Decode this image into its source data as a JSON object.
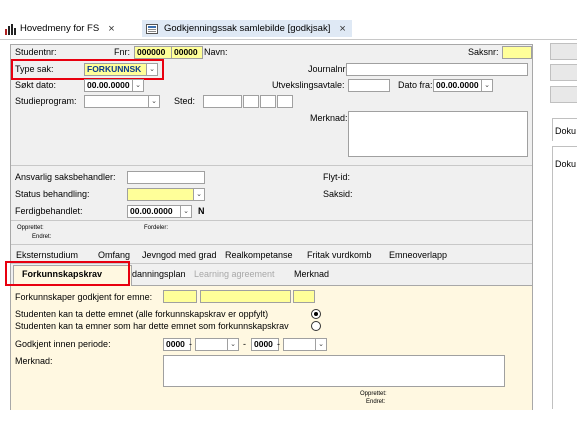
{
  "app_tabs": [
    {
      "label": "Hovedmeny for FS",
      "close": "×"
    },
    {
      "label": "Godkjenningssak samlebilde  [godkjsak]",
      "close": "×"
    }
  ],
  "header": {
    "studentnr_label": "Studentnr:",
    "fnr_label": "Fnr:",
    "fnr_value1": "000000",
    "fnr_value2": "00000",
    "navn_label": "Navn:",
    "saksnr_label": "Saksnr:",
    "type_sak_label": "Type sak:",
    "type_sak_value": "FORKUNNSK",
    "journalnr_label": "Journalnr:",
    "sokt_dato_label": "Søkt dato:",
    "sokt_dato_value": "00.00.0000",
    "utvekslingsavtale_label": "Utvekslingsavtale:",
    "dato_fra_label": "Dato fra:",
    "dato_fra_value": "00.00.0000",
    "studieprogram_label": "Studieprogram:",
    "sted_label": "Sted:",
    "merknad_label": "Merknad:"
  },
  "behandling": {
    "ansvarlig_label": "Ansvarlig saksbehandler:",
    "flyt_id_label": "Flyt-id:",
    "status_label": "Status behandling:",
    "saksid_label": "Saksid:",
    "ferdig_label": "Ferdigbehandlet:",
    "ferdig_value": "00.00.0000",
    "ferdig_flag": "N",
    "opprettet_label": "Opprettet:",
    "fordeler_label": "Fordeler:",
    "endret_label": "Endret:"
  },
  "tabs_row1": [
    "Eksternstudium",
    "Omfang",
    "Jevngod med grad",
    "Realkompetanse",
    "Fritak vurdkomb",
    "Emneoverlapp"
  ],
  "tabs_row2": [
    "Forkunnskapskrav",
    "Utdanningsplan",
    "Learning agreement",
    "Merknad"
  ],
  "panel": {
    "godkjent_label": "Forkunnskaper godkjent for emne:",
    "radio1_label": "Studenten kan ta dette emnet (alle forkunnskapskrav er oppfylt)",
    "radio2_label": "Studenten kan ta emner som har dette emnet som forkunnskapskrav",
    "periode_label": "Godkjent innen periode:",
    "periode_from": "0000",
    "periode_sep": "-",
    "periode_to": "0000",
    "merknad_label": "Merknad:",
    "opprettet_label": "Opprettet:",
    "endret_label": "Endret:"
  },
  "right_pane": {
    "doku1": "Doku",
    "doku2": "Doku"
  },
  "colors": {
    "highlight": "#e8000f",
    "mandatory": "#ffff99",
    "panel": "#fff8e1"
  }
}
